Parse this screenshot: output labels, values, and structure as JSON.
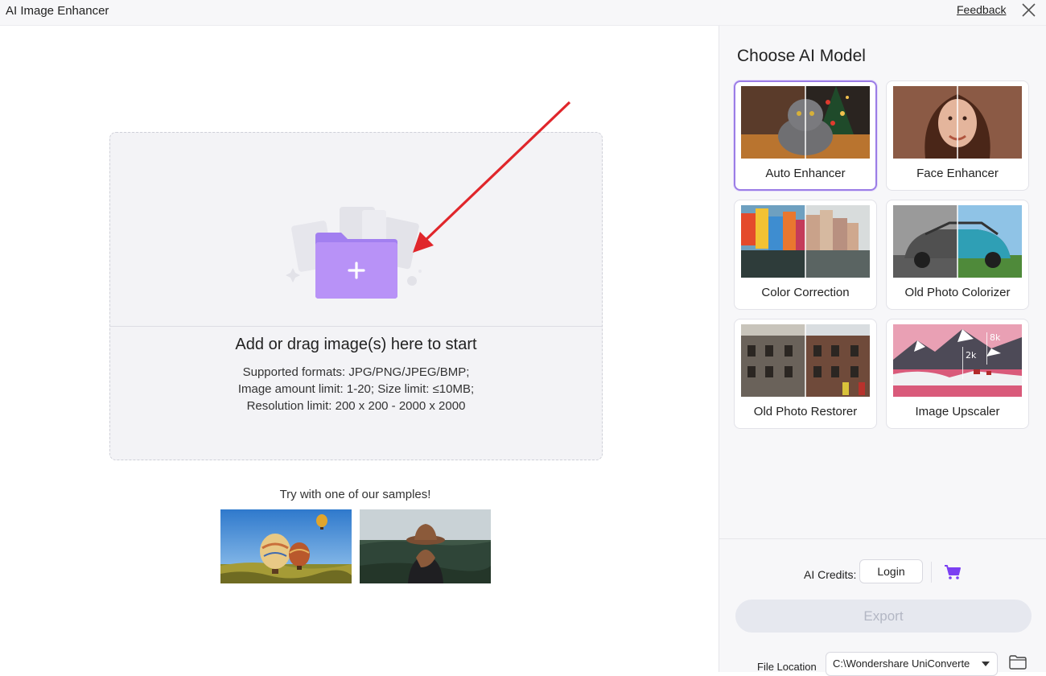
{
  "titlebar": {
    "app_title": "AI Image Enhancer",
    "feedback_label": "Feedback",
    "close_icon": "close-icon"
  },
  "dropzone": {
    "title": "Add or drag image(s) here to start",
    "formats": "Supported formats: JPG/PNG/JPEG/BMP;",
    "amount": "Image amount limit: 1-20; Size limit: ≤10MB;",
    "resolution": "Resolution limit: 200 x 200 - 2000 x 2000",
    "icon": "add-folder-icon",
    "accent_color": "#b18cf5"
  },
  "samples": {
    "label": "Try with one of our samples!",
    "items": [
      "hot-air-balloons",
      "woman-in-hat"
    ]
  },
  "panel": {
    "title": "Choose AI Model",
    "selected": "Auto Enhancer",
    "models": [
      {
        "label": "Auto Enhancer"
      },
      {
        "label": "Face Enhancer"
      },
      {
        "label": "Color Correction"
      },
      {
        "label": "Old Photo Colorizer"
      },
      {
        "label": "Old Photo Restorer"
      },
      {
        "label": "Image Upscaler"
      }
    ],
    "upscaler_badges": [
      "8k",
      "2k"
    ]
  },
  "footer": {
    "credits_label": "AI Credits:",
    "login_label": "Login",
    "cart_icon": "cart-icon",
    "export_label": "Export",
    "file_location_label": "File Location",
    "file_location_value": "C:\\Wondershare UniConverte",
    "folder_icon": "folder-icon",
    "accent_color": "#7b3ff2"
  }
}
